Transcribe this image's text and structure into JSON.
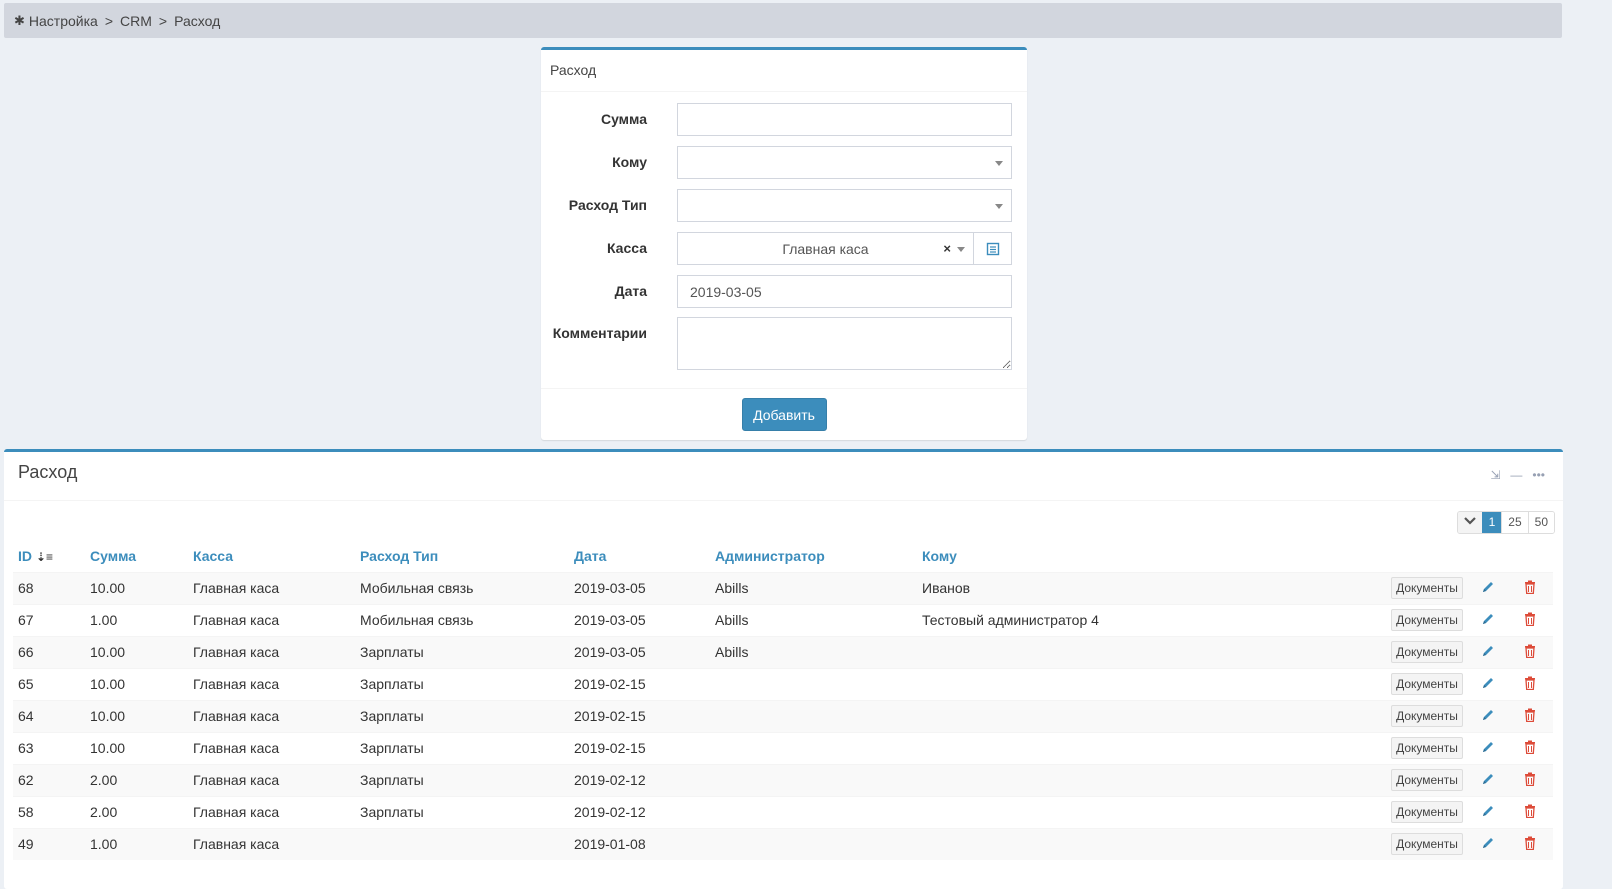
{
  "breadcrumb": {
    "items": [
      "Настройка",
      "CRM",
      "Расход"
    ],
    "separator": ">"
  },
  "form": {
    "title": "Расход",
    "fields": {
      "amount_label": "Сумма",
      "amount_value": "",
      "to_label": "Кому",
      "to_value": "",
      "type_label": "Расход Тип",
      "type_value": "",
      "cashbox_label": "Касса",
      "cashbox_value": "Главная каса",
      "date_label": "Дата",
      "date_value": "2019-03-05",
      "comment_label": "Комментарии",
      "comment_value": ""
    },
    "submit_label": "Добавить"
  },
  "table": {
    "title": "Расход",
    "page_sizes": [
      "1",
      "25",
      "50"
    ],
    "active_page_size": "1",
    "columns": [
      "ID",
      "Сумма",
      "Касса",
      "Расход Тип",
      "Дата",
      "Администратор",
      "Кому"
    ],
    "documents_label": "Документы",
    "rows": [
      [
        "68",
        "10.00",
        "Главная каса",
        "Мобильная связь",
        "2019-03-05",
        "Abills",
        "Иванов"
      ],
      [
        "67",
        "1.00",
        "Главная каса",
        "Мобильная связь",
        "2019-03-05",
        "Abills",
        "Тестовый администратор 4"
      ],
      [
        "66",
        "10.00",
        "Главная каса",
        "Зарплаты",
        "2019-03-05",
        "Abills",
        ""
      ],
      [
        "65",
        "10.00",
        "Главная каса",
        "Зарплаты",
        "2019-02-15",
        "",
        ""
      ],
      [
        "64",
        "10.00",
        "Главная каса",
        "Зарплаты",
        "2019-02-15",
        "",
        ""
      ],
      [
        "63",
        "10.00",
        "Главная каса",
        "Зарплаты",
        "2019-02-15",
        "",
        ""
      ],
      [
        "62",
        "2.00",
        "Главная каса",
        "Зарплаты",
        "2019-02-12",
        "",
        ""
      ],
      [
        "58",
        "2.00",
        "Главная каса",
        "Зарплаты",
        "2019-02-12",
        "",
        ""
      ],
      [
        "49",
        "1.00",
        "Главная каса",
        "",
        "2019-01-08",
        "",
        ""
      ]
    ]
  },
  "colors": {
    "accent": "#3c8dbc",
    "delete": "#dd4b39",
    "background": "#ecf0f5"
  }
}
